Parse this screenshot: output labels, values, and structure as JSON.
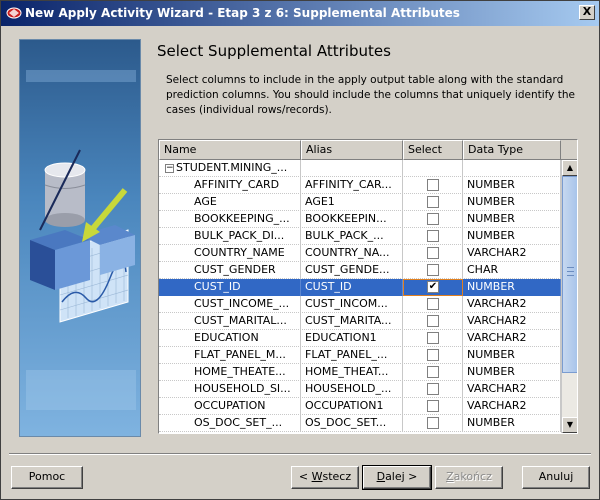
{
  "window": {
    "title": "New Apply Activity Wizard - Etap 3 z 6: Supplemental Attributes",
    "close_label": "X"
  },
  "page": {
    "heading": "Select Supplemental Attributes",
    "description": "Select columns to include in the apply output table along with the standard prediction columns. You should include the columns that uniquely identify the cases (individual rows/records)."
  },
  "grid": {
    "columns": [
      "Name",
      "Alias",
      "Select",
      "Data Type"
    ],
    "group": {
      "expander": "−",
      "label": "STUDENT.MINING_..."
    },
    "rows": [
      {
        "name": "AFFINITY_CARD",
        "alias": "AFFINITY_CAR...",
        "checked": false,
        "type": "NUMBER"
      },
      {
        "name": "AGE",
        "alias": "AGE1",
        "checked": false,
        "type": "NUMBER"
      },
      {
        "name": "BOOKKEEPING_...",
        "alias": "BOOKKEEPIN...",
        "checked": false,
        "type": "NUMBER"
      },
      {
        "name": "BULK_PACK_DI...",
        "alias": "BULK_PACK_...",
        "checked": false,
        "type": "NUMBER"
      },
      {
        "name": "COUNTRY_NAME",
        "alias": "COUNTRY_NA...",
        "checked": false,
        "type": "VARCHAR2"
      },
      {
        "name": "CUST_GENDER",
        "alias": "CUST_GENDE...",
        "checked": false,
        "type": "CHAR"
      },
      {
        "name": "CUST_ID",
        "alias": "CUST_ID",
        "checked": true,
        "type": "NUMBER",
        "selected": true
      },
      {
        "name": "CUST_INCOME_...",
        "alias": "CUST_INCOM...",
        "checked": false,
        "type": "VARCHAR2"
      },
      {
        "name": "CUST_MARITAL...",
        "alias": "CUST_MARITA...",
        "checked": false,
        "type": "VARCHAR2"
      },
      {
        "name": "EDUCATION",
        "alias": "EDUCATION1",
        "checked": false,
        "type": "VARCHAR2"
      },
      {
        "name": "FLAT_PANEL_M...",
        "alias": "FLAT_PANEL_...",
        "checked": false,
        "type": "NUMBER"
      },
      {
        "name": "HOME_THEATE...",
        "alias": "HOME_THEAT...",
        "checked": false,
        "type": "NUMBER"
      },
      {
        "name": "HOUSEHOLD_SI...",
        "alias": "HOUSEHOLD_...",
        "checked": false,
        "type": "VARCHAR2"
      },
      {
        "name": "OCCUPATION",
        "alias": "OCCUPATION1",
        "checked": false,
        "type": "VARCHAR2"
      },
      {
        "name": "OS_DOC_SET_...",
        "alias": "OS_DOC_SET...",
        "checked": false,
        "type": "NUMBER"
      }
    ]
  },
  "buttons": {
    "help": "Pomoc",
    "back_prefix": "< ",
    "back_key": "W",
    "back_rest": "stecz",
    "next_key": "D",
    "next_rest": "alej >",
    "finish_key": "Z",
    "finish_rest": "akończ",
    "cancel": "Anuluj"
  },
  "colors": {
    "selection": "#3168c5",
    "titlebar_start": "#0a246a",
    "titlebar_end": "#a6caf0",
    "focus_outline": "#e08020"
  },
  "icons": {
    "title": "oracle-wizard-icon",
    "side": "database-cube-illustration",
    "checkbox_checked": "✔"
  }
}
